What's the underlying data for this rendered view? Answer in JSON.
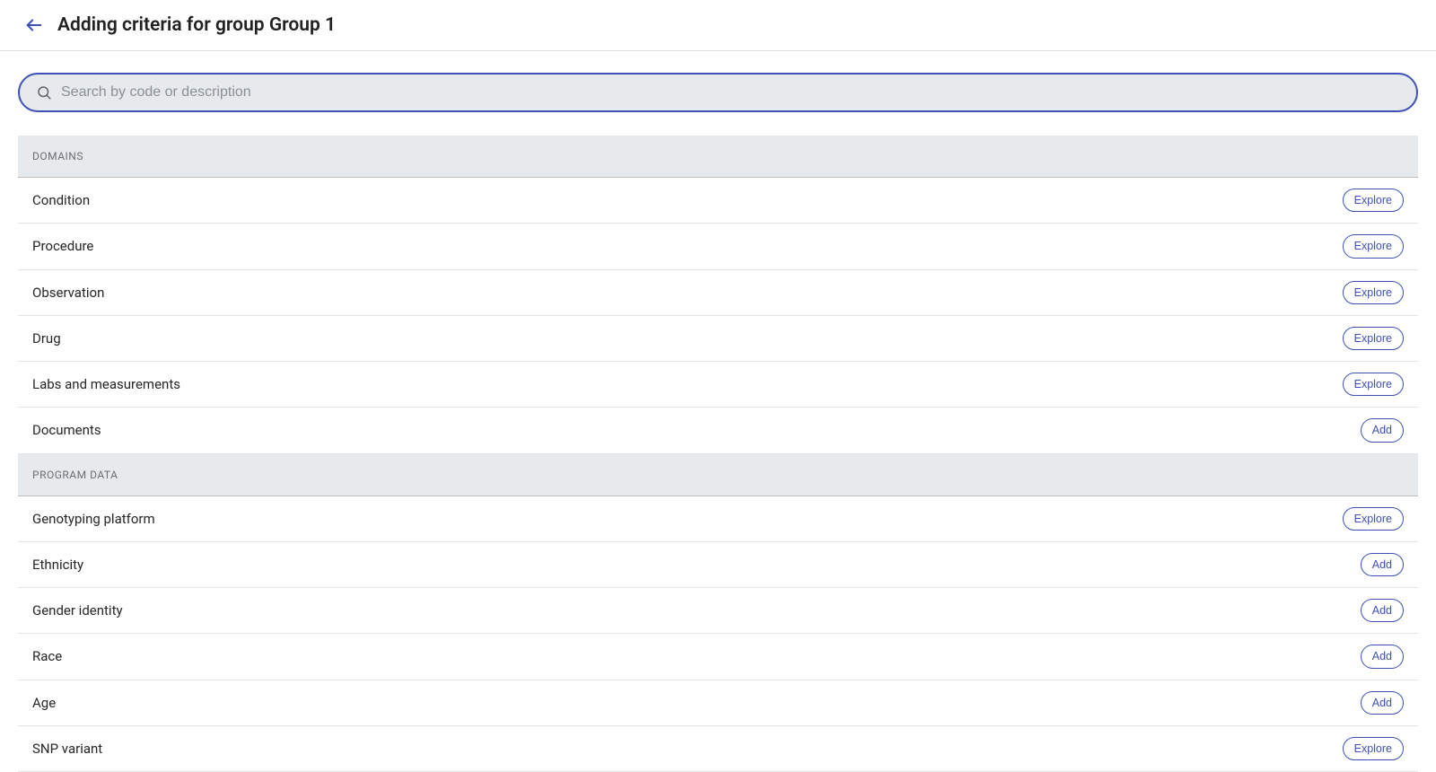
{
  "header": {
    "title": "Adding criteria for group Group 1"
  },
  "search": {
    "placeholder": "Search by code or description",
    "value": ""
  },
  "action_labels": {
    "explore": "Explore",
    "add": "Add"
  },
  "sections": [
    {
      "heading": "DOMAINS",
      "items": [
        {
          "label": "Condition",
          "action": "explore"
        },
        {
          "label": "Procedure",
          "action": "explore"
        },
        {
          "label": "Observation",
          "action": "explore"
        },
        {
          "label": "Drug",
          "action": "explore"
        },
        {
          "label": "Labs and measurements",
          "action": "explore"
        },
        {
          "label": "Documents",
          "action": "add"
        }
      ]
    },
    {
      "heading": "PROGRAM DATA",
      "items": [
        {
          "label": "Genotyping platform",
          "action": "explore"
        },
        {
          "label": "Ethnicity",
          "action": "add"
        },
        {
          "label": "Gender identity",
          "action": "add"
        },
        {
          "label": "Race",
          "action": "add"
        },
        {
          "label": "Age",
          "action": "add"
        },
        {
          "label": "SNP variant",
          "action": "explore"
        }
      ]
    }
  ]
}
